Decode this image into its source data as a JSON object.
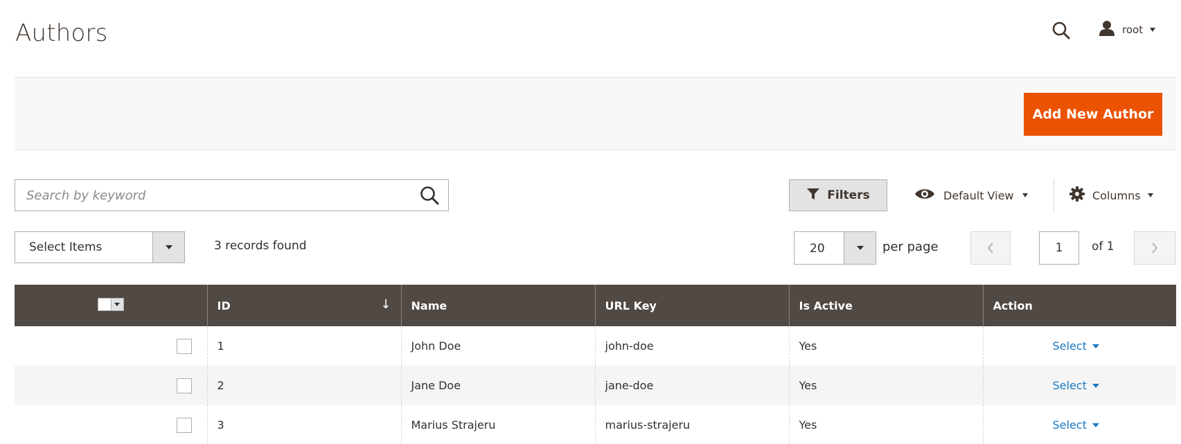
{
  "header": {
    "title": "Authors",
    "search_icon": "search-icon",
    "user_icon": "user-icon",
    "user_name": "root"
  },
  "action_bar": {
    "add_button_label": "Add New Author",
    "accent_color": "#eb5202"
  },
  "toolbar": {
    "search_placeholder": "Search by keyword",
    "filters_label": "Filters",
    "view_label": "Default View",
    "columns_label": "Columns",
    "mass_action_label": "Select Items",
    "records_found": "3 records found",
    "per_page_value": "20",
    "per_page_label": "per page",
    "current_page": "1",
    "page_of": "of 1"
  },
  "grid": {
    "columns": [
      "ID",
      "Name",
      "URL Key",
      "Is Active",
      "Action"
    ],
    "header_color": "#514943",
    "rows": [
      {
        "id": "1",
        "name": "John Doe",
        "url_key": "john-doe",
        "is_active": "Yes",
        "action": "Select"
      },
      {
        "id": "2",
        "name": "Jane Doe",
        "url_key": "jane-doe",
        "is_active": "Yes",
        "action": "Select"
      },
      {
        "id": "3",
        "name": "Marius Strajeru",
        "url_key": "marius-strajeru",
        "is_active": "Yes",
        "action": "Select"
      }
    ],
    "link_color": "#1979c3"
  }
}
